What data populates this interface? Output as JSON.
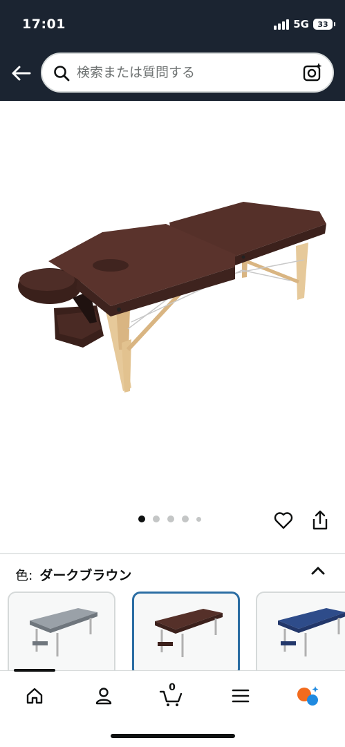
{
  "status": {
    "time": "17:01",
    "network": "5G",
    "battery": "33"
  },
  "search": {
    "placeholder": "検索または質問する"
  },
  "product": {
    "carousel_total": 5,
    "carousel_active": 0
  },
  "variant": {
    "label": "色:",
    "value": "ダークブラウン",
    "swatches": [
      {
        "name": "gray",
        "color": "#9aa1a8"
      },
      {
        "name": "dark-brown",
        "color": "#4a2a24",
        "selected": true
      },
      {
        "name": "navy",
        "color": "#2e4c8a"
      }
    ]
  },
  "tabbar": {
    "cart_count": "0"
  },
  "colors": {
    "header_bg": "#1b2431",
    "selected_border": "#2b6da3",
    "brown": "#4a2a24"
  }
}
